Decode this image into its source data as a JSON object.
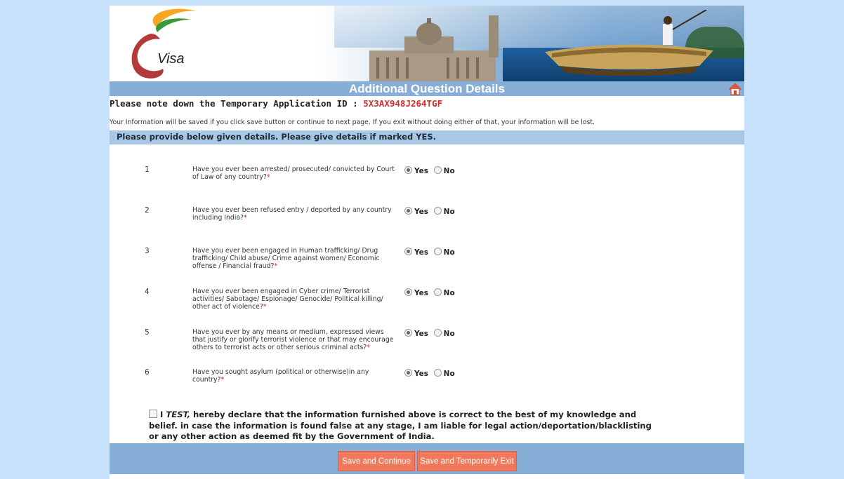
{
  "header": {
    "logo_text": "Visa",
    "title": "Additional Question Details"
  },
  "application": {
    "id_label": "Please note down the Temporary Application ID : ",
    "id_value": "5X3AX948J264TGF",
    "info_note": "Your Information will be saved if you click save button or continue to next page. If you exit without doing either of that, your information will be lost."
  },
  "section": {
    "instructions": "Please provide below given details. Please give details if marked YES."
  },
  "options": {
    "yes_label": "Yes",
    "no_label": "No"
  },
  "questions": [
    {
      "number": "1",
      "text": "Have you ever been arrested/ prosecuted/ convicted by Court of Law of any country?",
      "answer": "Yes"
    },
    {
      "number": "2",
      "text": "Have you ever been refused entry / deported by any country including India?",
      "answer": "Yes"
    },
    {
      "number": "3",
      "text": "Have you ever been engaged in Human trafficking/ Drug trafficking/ Child abuse/ Crime against women/ Economic offense / Financial fraud?",
      "answer": "Yes"
    },
    {
      "number": "4",
      "text": "Have you ever been engaged in Cyber crime/ Terrorist activities/ Sabotage/ Espionage/ Genocide/ Political killing/ other act of violence?",
      "answer": "Yes"
    },
    {
      "number": "5",
      "text": "Have you ever by any means or medium, expressed views that justify or glorify terrorist violence or that may encourage others to terrorist acts or other serious criminal acts?",
      "answer": "Yes"
    },
    {
      "number": "6",
      "text": "Have you sought asylum (political or otherwise)in any country?",
      "answer": "Yes"
    }
  ],
  "required_mark": "*",
  "declaration": {
    "prefix": "I ",
    "name": "TEST,",
    "text": " hereby declare that the information furnished above is correct to the best of my knowledge and belief. in case the information is found false at any stage, I am liable for legal action/deportation/blacklisting or any other action as deemed fit by the Government of India.",
    "checked": false
  },
  "buttons": {
    "save_continue": "Save and Continue",
    "save_exit": "Save and Temporarily Exit"
  },
  "colors": {
    "page_bg": "#c8e2fb",
    "title_bar": "#86aed6",
    "section_bar": "#a9c8e6",
    "button": "#f0795c",
    "id_value": "#d62b2b"
  }
}
